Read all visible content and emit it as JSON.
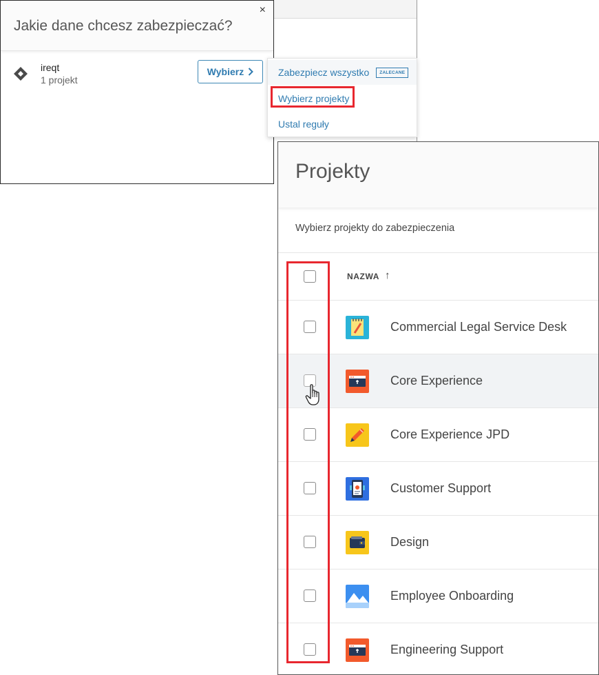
{
  "dialog": {
    "title": "Jakie dane chcesz zabezpieczać?",
    "close_glyph": "×",
    "org": {
      "name": "ireqt",
      "project_count": "1 projekt",
      "icon": "diamond-org-icon"
    },
    "select_button": "Wybierz",
    "select_chevron": "›"
  },
  "menu": {
    "items": [
      {
        "label": "Zabezpiecz wszystko",
        "badge": "ZALECANE"
      },
      {
        "label": "Wybierz projekty"
      },
      {
        "label": "Ustal reguły"
      }
    ],
    "highlighted_item": "Wybierz projekty"
  },
  "projects_panel": {
    "title": "Projekty",
    "subtitle": "Wybierz projekty do zabezpieczenia",
    "column_header": "NAZWA",
    "sort_arrow": "↑",
    "rows": [
      {
        "name": "Commercial Legal Service Desk",
        "icon": "notepad-pencil-icon",
        "checked": false
      },
      {
        "name": "Core Experience",
        "icon": "browser-window-icon",
        "checked": false,
        "hovered": true
      },
      {
        "name": "Core Experience JPD",
        "icon": "pencil-icon",
        "checked": false
      },
      {
        "name": "Customer Support",
        "icon": "phone-support-icon",
        "checked": false
      },
      {
        "name": "Design",
        "icon": "wallet-icon",
        "checked": false
      },
      {
        "name": "Employee Onboarding",
        "icon": "mountains-icon",
        "checked": false
      },
      {
        "name": "Engineering Support",
        "icon": "browser-window-icon",
        "checked": false
      }
    ]
  },
  "colors": {
    "link_blue": "#2f7bb0",
    "highlight_red": "#e8272f"
  }
}
